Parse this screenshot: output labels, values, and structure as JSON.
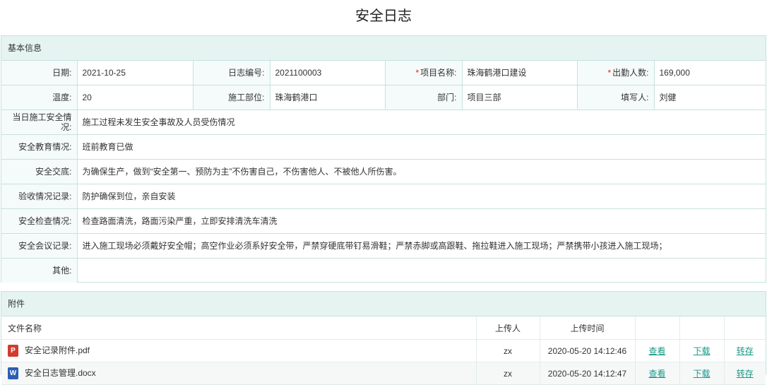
{
  "page_title": "安全日志",
  "basic": {
    "section_title": "基本信息",
    "date": {
      "label": "日期:",
      "value": "2021-10-25"
    },
    "log_no": {
      "label": "日志编号:",
      "value": "2021100003"
    },
    "project_name": {
      "required_mark": "*",
      "label": "项目名称:",
      "value": "珠海鹤港口建设"
    },
    "attendance": {
      "required_mark": "*",
      "label": "出勤人数:",
      "value": "169,000"
    },
    "temperature": {
      "label": "温度:",
      "value": "20"
    },
    "construction_site": {
      "label": "施工部位:",
      "value": "珠海鹤港口"
    },
    "department": {
      "label": "部门:",
      "value": "项目三部"
    },
    "filler": {
      "label": "填写人:",
      "value": "刘健"
    },
    "daily_safety": {
      "label": "当日施工安全情况:",
      "value": "施工过程未发生安全事故及人员受伤情况"
    },
    "safety_education": {
      "label": "安全教育情况:",
      "value": "班前教育已做"
    },
    "safety_briefing": {
      "label": "安全交底:",
      "value": "为确保生产，做到“安全第一、预防为主”不伤害自己，不伤害他人、不被他人所伤害。"
    },
    "acceptance": {
      "label": "验收情况记录:",
      "value": "防护确保到位，亲自安装"
    },
    "safety_inspection": {
      "label": "安全检查情况:",
      "value": "检查路面清洗，路面污染严重，立即安排清洗车清洗"
    },
    "safety_meeting": {
      "label": "安全会议记录:",
      "value": "进入施工现场必须戴好安全帽；高空作业必须系好安全带，严禁穿硬底带钉易滑鞋；严禁赤脚或高跟鞋、拖拉鞋进入施工现场；严禁携带小孩进入施工现场；"
    },
    "other": {
      "label": "其他:",
      "value": ""
    }
  },
  "attachments": {
    "section_title": "附件",
    "headers": {
      "name": "文件名称",
      "uploader": "上传人",
      "time": "上传时间"
    },
    "files": [
      {
        "icon": "pdf-file-icon",
        "icon_text": "P",
        "name": "安全记录附件.pdf",
        "uploader": "zx",
        "time": "2020-05-20 14:12:46",
        "view": "查看",
        "download": "下载",
        "transfer": "转存"
      },
      {
        "icon": "word-file-icon",
        "icon_text": "W",
        "name": "安全日志管理.docx",
        "uploader": "zx",
        "time": "2020-05-20 14:12:47",
        "view": "查看",
        "download": "下载",
        "transfer": "转存"
      }
    ]
  },
  "colors": {
    "accent": "#1a9a87",
    "header_bg": "#e5f4f1",
    "border": "#c6e2dd",
    "required": "#e02020"
  }
}
